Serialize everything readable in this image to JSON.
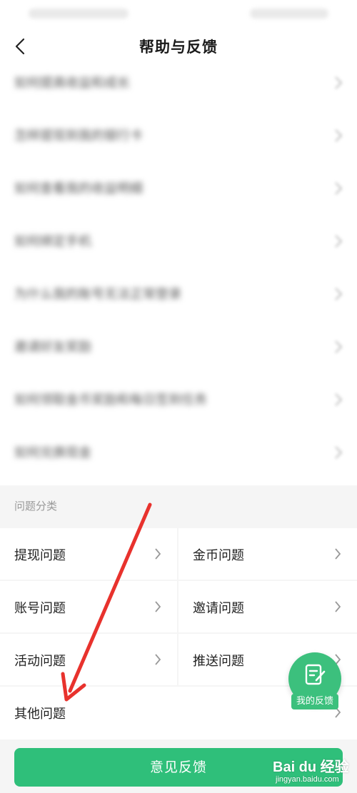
{
  "header": {
    "title": "帮助与反馈",
    "back_icon": "chevron-left-icon"
  },
  "faq": {
    "items": [
      {
        "label": "如何提高收益和成长"
      },
      {
        "label": "怎样提现到我的银行卡"
      },
      {
        "label": "如何查看我的收益明细"
      },
      {
        "label": "如何绑定手机"
      },
      {
        "label": "为什么我的账号无法正常登录"
      },
      {
        "label": "邀请好友奖励"
      },
      {
        "label": "如何领取金币奖励和每日签到任务"
      },
      {
        "label": "如何兑换现金"
      }
    ]
  },
  "categories": {
    "section_label": "问题分类",
    "items": [
      {
        "label": "提现问题"
      },
      {
        "label": "金币问题"
      },
      {
        "label": "账号问题"
      },
      {
        "label": "邀请问题"
      },
      {
        "label": "活动问题"
      },
      {
        "label": "推送问题"
      },
      {
        "label": "其他问题"
      }
    ]
  },
  "fab": {
    "label": "我的反馈",
    "icon": "edit-note-icon"
  },
  "submit": {
    "label": "意见反馈"
  },
  "colors": {
    "accent": "#2fbf7a",
    "arrow": "#e8322d"
  },
  "watermark": {
    "main": "Bai du 经验",
    "sub": "jingyan.baidu.com"
  }
}
